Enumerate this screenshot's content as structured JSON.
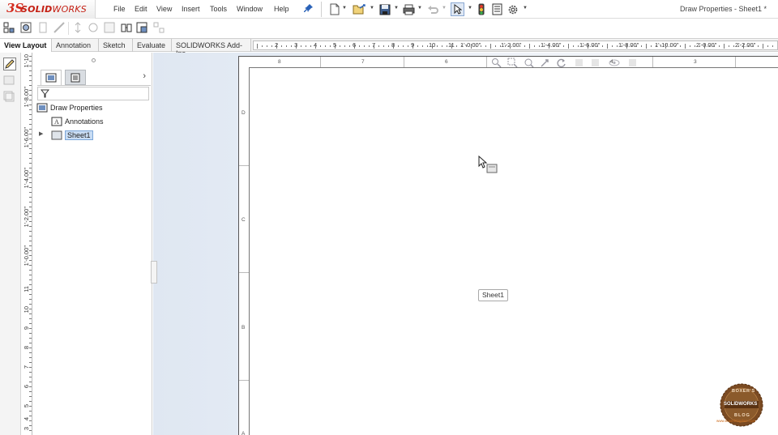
{
  "app": {
    "logo_ds": "3S",
    "logo_solid": "SOLID",
    "logo_works": "WORKS",
    "document_title": "Draw Properties - Sheet1 *"
  },
  "menu": [
    "File",
    "Edit",
    "View",
    "Insert",
    "Tools",
    "Window",
    "Help"
  ],
  "toolbar_icons": [
    "new-document-icon",
    "open-icon",
    "save-icon",
    "print-icon",
    "undo-icon",
    "select-icon",
    "rebuild-icon",
    "file-properties-icon",
    "options-icon"
  ],
  "command_tabs": {
    "items": [
      "View Layout",
      "Annotation",
      "Sketch",
      "Evaluate",
      "SOLIDWORKS Add-Ins"
    ],
    "active": "View Layout"
  },
  "horizontal_ruler": {
    "labels": [
      "2",
      "3",
      "4",
      "5",
      "6",
      "7",
      "8",
      "9",
      "10",
      "11",
      "1'-0.00\"",
      "1'-2.00\"",
      "1'-4.00\"",
      "1'-6.00\"",
      "1'-8.00\"",
      "1'-10.00\"",
      "2'-0.00\"",
      "2'-2.00\""
    ]
  },
  "vertical_ruler": {
    "labels": [
      "1'-10",
      "1'-8.00\"",
      "1'-6.00\"",
      "1'-4.00\"",
      "1'-2.00\"",
      "1'-0.00\"",
      "11",
      "10",
      "9",
      "8",
      "7",
      "6",
      "5",
      "4",
      "3"
    ]
  },
  "feature_manager": {
    "tree": {
      "root": "Draw Properties",
      "annotations": "Annotations",
      "sheet": "Sheet1"
    }
  },
  "sheet": {
    "zones_top": [
      "8",
      "7",
      "6",
      "4",
      "3"
    ],
    "zones_left": [
      "D",
      "C",
      "B",
      "A"
    ],
    "tooltip": "Sheet1"
  },
  "colors": {
    "brand_red": "#d42b1e",
    "selection_blue": "#c8dcf3",
    "graphics_bg": "#e5ecf5"
  },
  "watermark": {
    "top": "BOXER'S",
    "middle": "SOLIDWORKS",
    "bottom": "BLOG",
    "url": "www.boxerblogdws.com"
  }
}
